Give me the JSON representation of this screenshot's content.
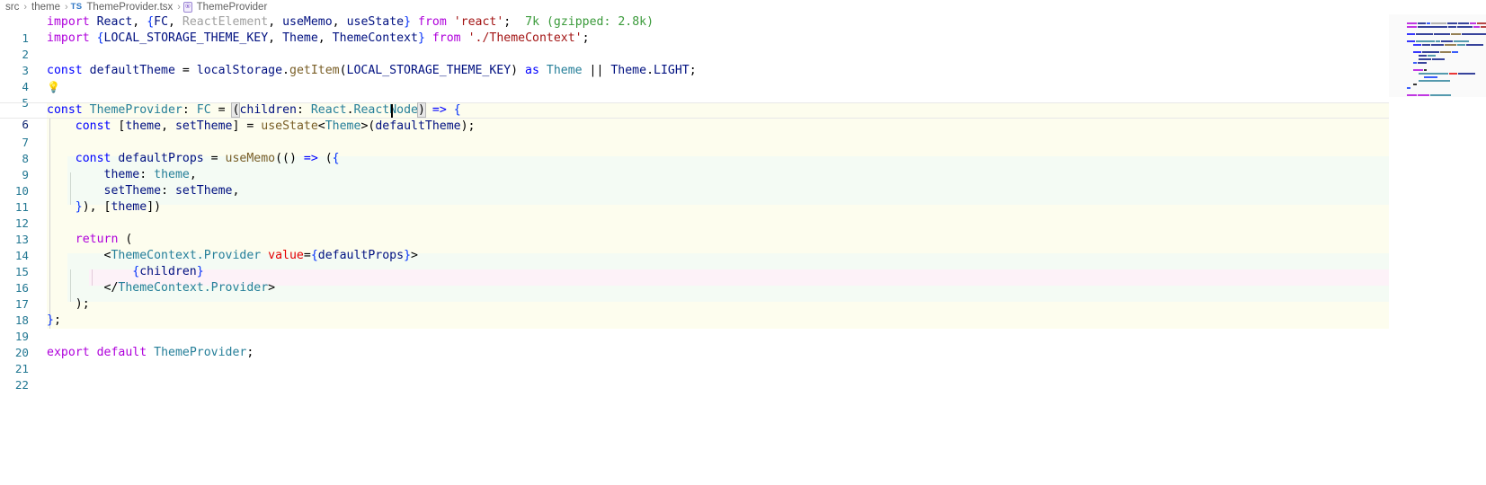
{
  "breadcrumb": {
    "name": "breadcrumb",
    "items": [
      {
        "label": "src",
        "icon": null
      },
      {
        "label": "theme",
        "icon": null
      },
      {
        "label": "ThemeProvider.tsx",
        "icon": "typescript-file-icon",
        "icon_text": "TS"
      },
      {
        "label": "ThemeProvider",
        "icon": "symbol-function-icon",
        "icon_text": "⍟"
      }
    ],
    "separator": "›"
  },
  "editor": {
    "name": "code-editor",
    "language": "typescriptreact",
    "file": "ThemeProvider.tsx",
    "active_line": 6,
    "cursor": {
      "line": 6,
      "column": 44
    },
    "inline_hint": "7k (gzipped: 2.8k)",
    "lightbulb_line": 5,
    "lightbulb_icon": "lightbulb-icon",
    "line_numbers": [
      "1",
      "2",
      "3",
      "4",
      "5",
      "6",
      "7",
      "8",
      "9",
      "10",
      "11",
      "12",
      "13",
      "14",
      "15",
      "16",
      "17",
      "18",
      "19",
      "20",
      "21",
      "22"
    ],
    "lines": [
      {
        "n": 1,
        "text": "import React, {FC, ReactElement, useMemo, useState} from 'react';"
      },
      {
        "n": 2,
        "text": "import {LOCAL_STORAGE_THEME_KEY, Theme, ThemeContext} from './ThemeContext';"
      },
      {
        "n": 3,
        "text": ""
      },
      {
        "n": 4,
        "text": "const defaultTheme = localStorage.getItem(LOCAL_STORAGE_THEME_KEY) as Theme || Theme.LIGHT;"
      },
      {
        "n": 5,
        "text": ""
      },
      {
        "n": 6,
        "text": "const ThemeProvider: FC = (children: React.ReactNode) => {"
      },
      {
        "n": 7,
        "text": "    const [theme, setTheme] = useState<Theme>(defaultTheme);"
      },
      {
        "n": 8,
        "text": ""
      },
      {
        "n": 9,
        "text": "    const defaultProps = useMemo(() => ({"
      },
      {
        "n": 10,
        "text": "        theme: theme,"
      },
      {
        "n": 11,
        "text": "        setTheme: setTheme,"
      },
      {
        "n": 12,
        "text": "    }), [theme])"
      },
      {
        "n": 13,
        "text": ""
      },
      {
        "n": 14,
        "text": "    return ("
      },
      {
        "n": 15,
        "text": "        <ThemeContext.Provider value={defaultProps}>"
      },
      {
        "n": 16,
        "text": "            {children}"
      },
      {
        "n": 17,
        "text": "        </ThemeContext.Provider>"
      },
      {
        "n": 18,
        "text": "    );"
      },
      {
        "n": 19,
        "text": "};"
      },
      {
        "n": 20,
        "text": ""
      },
      {
        "n": 21,
        "text": "export default ThemeProvider;"
      },
      {
        "n": 22,
        "text": ""
      }
    ]
  },
  "minimap": {
    "name": "minimap",
    "visible": true
  },
  "colors": {
    "background": "#ffffff",
    "keyword": "#0000ff",
    "keyword_purple": "#af00db",
    "variable": "#001080",
    "type": "#267f99",
    "function": "#795e26",
    "string": "#a31515",
    "number": "#098658",
    "unused": "#a0a0a0",
    "jsx_attribute": "#e50000",
    "brace": "#0431fa",
    "inline_hint": "#3a9a3a",
    "line_number": "#237893",
    "active_line_number": "#0b216f",
    "scope_highlight": "#fdfdee",
    "lightbulb": "#e5c100"
  }
}
